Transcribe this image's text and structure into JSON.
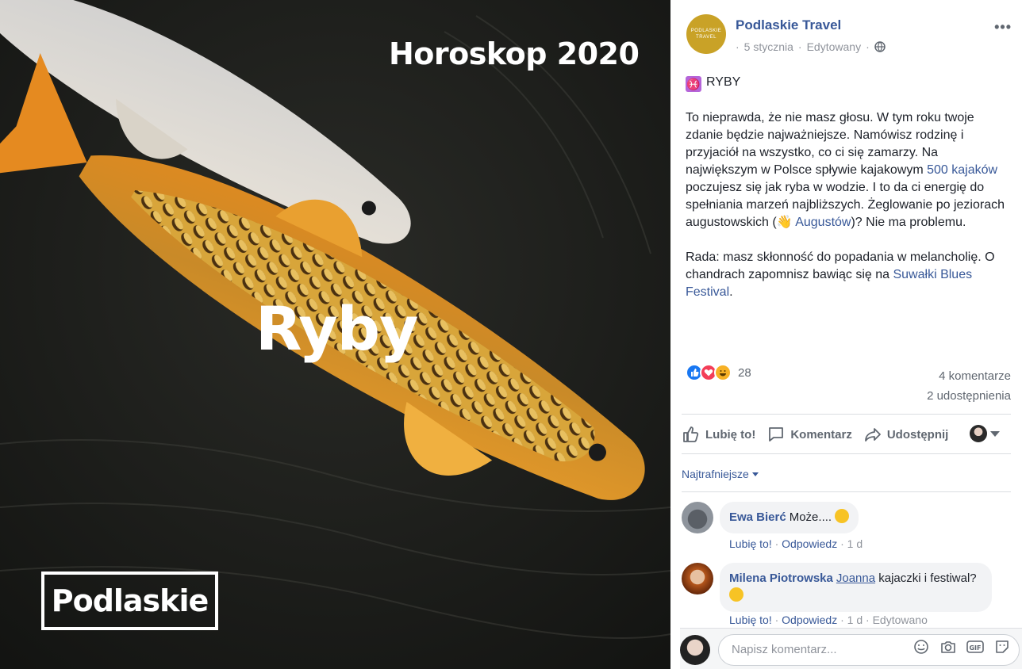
{
  "photo": {
    "overlay_title": "Horoskop 2020",
    "overlay_ryby": "Ryby",
    "logo_text": "Podlaskie"
  },
  "post": {
    "page_name": "Podlaskie Travel",
    "avatar_line1": "PODLASKIE",
    "avatar_line2": "TRAVEL",
    "date": "5 stycznia",
    "edited": "Edytowany",
    "sep": "·",
    "sign_glyph": "♓",
    "heading": "RYBY",
    "p1_a": "To nieprawda, że nie masz głosu. W tym roku twoje zdanie będzie najważniejsze. Namówisz rodzinę i przyjaciół na wszystko, co ci się zamarzy. Na największym w Polsce spływie kajakowym ",
    "p1_link1": "500 kajaków",
    "p1_b": " poczujesz się jak ryba w wodzie. I to da ci energię do spełniania marzeń najbliższych. Żeglowanie po jeziorach augustowskich (",
    "wave_emoji": "👋",
    "p1_link2": "Augustów",
    "p1_c": ")? Nie ma problemu.",
    "p2_a": "Rada: masz skłonność do popadania w melancholię. O chandrach zapomnisz bawiąc się na ",
    "p2_link": "Suwałki Blues Festival",
    "p2_b": "."
  },
  "stats": {
    "reaction_count": "28",
    "comments": "4 komentarze",
    "shares": "2 udostępnienia"
  },
  "actions": {
    "like": "Lubię to!",
    "comment": "Komentarz",
    "share": "Udostępnij"
  },
  "sort_label": "Najtrafniejsze",
  "comments": [
    {
      "author": "Ewa Bierć",
      "text": "Może....",
      "like": "Lubię to!",
      "reply": "Odpowiedz",
      "time": "1 d"
    },
    {
      "author": "Milena Piotrowska",
      "tag": "Joanna",
      "text": " kajaczki i festiwal?",
      "like": "Lubię to!",
      "reply": "Odpowiedz",
      "time": "1 d",
      "edited": "Edytowano"
    }
  ],
  "write": {
    "placeholder": "Napisz komentarz..."
  },
  "colors": {
    "link": "#385898",
    "accent_avatar": "#c9a227"
  }
}
